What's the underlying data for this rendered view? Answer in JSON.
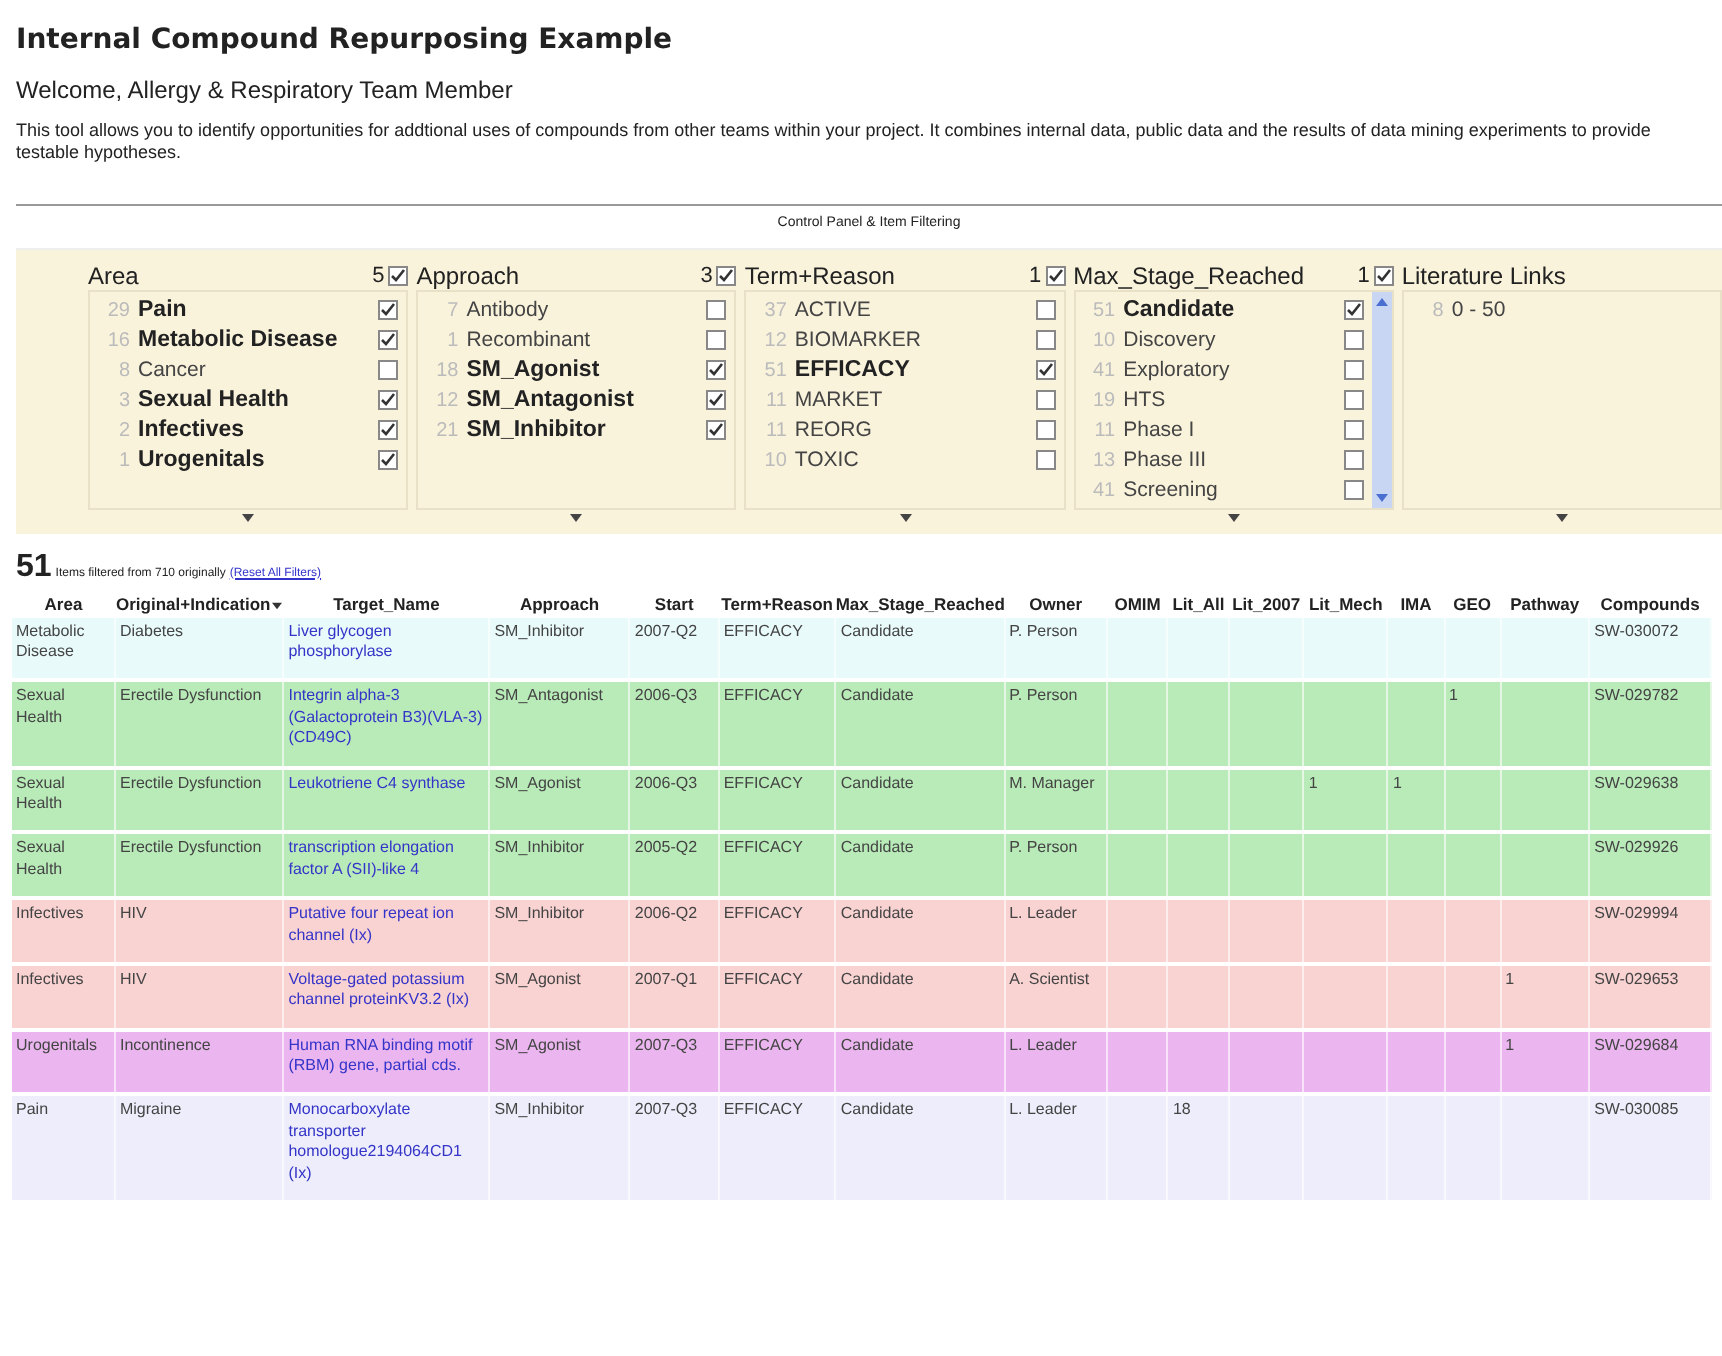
{
  "title": "Internal Compound Repurposing Example",
  "welcome": "Welcome, Allergy & Respiratory Team Member",
  "description": "This tool allows you to identify opportunities for addtional uses of compounds from other teams within your project. It combines internal data, public data and the results of data mining experiments to provide testable hypotheses.",
  "panel_title": "Control Panel & Item Filtering",
  "facets": [
    {
      "kind": "checklist",
      "title": "Area",
      "count": "5",
      "checked": true,
      "scrollbar": false,
      "items": [
        {
          "count": "29",
          "label": "Pain",
          "checked": true
        },
        {
          "count": "16",
          "label": "Metabolic Disease",
          "checked": true
        },
        {
          "count": "8",
          "label": "Cancer",
          "checked": false
        },
        {
          "count": "3",
          "label": "Sexual Health",
          "checked": true
        },
        {
          "count": "2",
          "label": "Infectives",
          "checked": true
        },
        {
          "count": "1",
          "label": "Urogenitals",
          "checked": true
        }
      ]
    },
    {
      "kind": "checklist",
      "title": "Approach",
      "count": "3",
      "checked": true,
      "scrollbar": false,
      "items": [
        {
          "count": "7",
          "label": "Antibody",
          "checked": false
        },
        {
          "count": "1",
          "label": "Recombinant",
          "checked": false
        },
        {
          "count": "18",
          "label": "SM_Agonist",
          "checked": true
        },
        {
          "count": "12",
          "label": "SM_Antagonist",
          "checked": true
        },
        {
          "count": "21",
          "label": "SM_Inhibitor",
          "checked": true
        }
      ]
    },
    {
      "kind": "checklist",
      "title": "Term+Reason",
      "count": "1",
      "checked": true,
      "scrollbar": false,
      "items": [
        {
          "count": "37",
          "label": "ACTIVE",
          "checked": false
        },
        {
          "count": "12",
          "label": "BIOMARKER",
          "checked": false
        },
        {
          "count": "51",
          "label": "EFFICACY",
          "checked": true
        },
        {
          "count": "11",
          "label": "MARKET",
          "checked": false
        },
        {
          "count": "11",
          "label": "REORG",
          "checked": false
        },
        {
          "count": "10",
          "label": "TOXIC",
          "checked": false
        }
      ]
    },
    {
      "kind": "checklist",
      "title": "Max_Stage_Reached",
      "count": "1",
      "checked": true,
      "scrollbar": true,
      "items": [
        {
          "count": "51",
          "label": "Candidate",
          "checked": true
        },
        {
          "count": "10",
          "label": "Discovery",
          "checked": false
        },
        {
          "count": "41",
          "label": "Exploratory",
          "checked": false
        },
        {
          "count": "19",
          "label": "HTS",
          "checked": false
        },
        {
          "count": "11",
          "label": "Phase I",
          "checked": false
        },
        {
          "count": "13",
          "label": "Phase III",
          "checked": false
        },
        {
          "count": "41",
          "label": "Screening",
          "checked": false
        }
      ]
    },
    {
      "kind": "range",
      "title": "Literature Links",
      "items": [
        {
          "count": "8",
          "label": "0 - 50"
        }
      ]
    }
  ],
  "summary": {
    "count": "51",
    "text": "Items filtered from 710 originally",
    "reset_link": "(Reset All Filters)"
  },
  "table": {
    "columns": [
      {
        "label": "Area",
        "sorted": false
      },
      {
        "label": "Original+Indication",
        "sorted": true
      },
      {
        "label": "Target_Name",
        "sorted": false
      },
      {
        "label": "Approach",
        "sorted": false
      },
      {
        "label": "Start",
        "sorted": false
      },
      {
        "label": "Term+Reason",
        "sorted": false
      },
      {
        "label": "Max_Stage_Reached",
        "sorted": false
      },
      {
        "label": "Owner",
        "sorted": false
      },
      {
        "label": "OMIM",
        "sorted": false
      },
      {
        "label": "Lit_All",
        "sorted": false
      },
      {
        "label": "Lit_2007",
        "sorted": false
      },
      {
        "label": "Lit_Mech",
        "sorted": false
      },
      {
        "label": "IMA",
        "sorted": false
      },
      {
        "label": "GEO",
        "sorted": false
      },
      {
        "label": "Pathway",
        "sorted": false
      },
      {
        "label": "Compounds",
        "sorted": false
      }
    ],
    "rows": [
      {
        "color": "#e8fafa",
        "cells": [
          "Metabolic Disease",
          "Diabetes",
          "Liver glycogen phosphorylase",
          "SM_Inhibitor",
          "2007-Q2",
          "EFFICACY",
          "Candidate",
          "P. Person",
          "",
          "",
          "",
          "",
          "",
          "",
          "",
          "SW-030072"
        ]
      },
      {
        "color": "#b9ebb9",
        "cells": [
          "Sexual Health",
          "Erectile Dysfunction",
          "Integrin alpha-3 (Galactoprotein B3)(VLA-3) (CD49C)",
          "SM_Antagonist",
          "2006-Q3",
          "EFFICACY",
          "Candidate",
          "P. Person",
          "",
          "",
          "",
          "",
          "",
          "1",
          "",
          "SW-029782"
        ]
      },
      {
        "color": "#b9ebb9",
        "cells": [
          "Sexual Health",
          "Erectile Dysfunction",
          "Leukotriene C4 synthase",
          "SM_Agonist",
          "2006-Q3",
          "EFFICACY",
          "Candidate",
          "M. Manager",
          "",
          "",
          "",
          "1",
          "1",
          "",
          "",
          "SW-029638"
        ]
      },
      {
        "color": "#b9ebb9",
        "cells": [
          "Sexual Health",
          "Erectile Dysfunction",
          "transcription elongation factor A (SII)-like 4",
          "SM_Inhibitor",
          "2005-Q2",
          "EFFICACY",
          "Candidate",
          "P. Person",
          "",
          "",
          "",
          "",
          "",
          "",
          "",
          "SW-029926"
        ]
      },
      {
        "color": "#f9d2d2",
        "cells": [
          "Infectives",
          "HIV",
          "Putative four repeat ion channel (Ix)",
          "SM_Inhibitor",
          "2006-Q2",
          "EFFICACY",
          "Candidate",
          "L. Leader",
          "",
          "",
          "",
          "",
          "",
          "",
          "",
          "SW-029994"
        ]
      },
      {
        "color": "#f9d2d2",
        "cells": [
          "Infectives",
          "HIV",
          "Voltage-gated potassium channel proteinKV3.2 (Ix)",
          "SM_Agonist",
          "2007-Q1",
          "EFFICACY",
          "Candidate",
          "A. Scientist",
          "",
          "",
          "",
          "",
          "",
          "",
          "1",
          "SW-029653"
        ]
      },
      {
        "color": "#ebb6ef",
        "cells": [
          "Urogenitals",
          "Incontinence",
          "Human RNA binding motif (RBM) gene, partial cds.",
          "SM_Agonist",
          "2007-Q3",
          "EFFICACY",
          "Candidate",
          "L. Leader",
          "",
          "",
          "",
          "",
          "",
          "",
          "1",
          "SW-029684"
        ]
      },
      {
        "color": "#ededfb",
        "cells": [
          "Pain",
          "Migraine",
          "Monocarboxylate transporter homologue2194064CD1 (Ix)",
          "SM_Inhibitor",
          "2007-Q3",
          "EFFICACY",
          "Candidate",
          "L. Leader",
          "",
          "18",
          "",
          "",
          "",
          "",
          "",
          "SW-030085"
        ]
      }
    ]
  }
}
